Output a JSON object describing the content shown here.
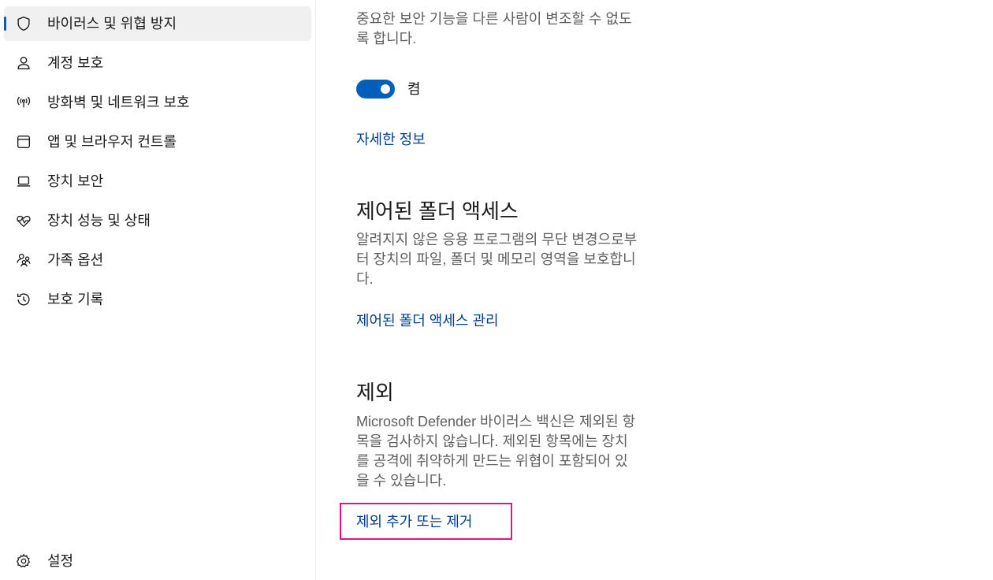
{
  "sidebar": {
    "items": [
      {
        "id": "virus",
        "label": "바이러스 및 위협 방지",
        "icon": "shield-icon",
        "selected": true
      },
      {
        "id": "account",
        "label": "계정 보호",
        "icon": "person-icon",
        "selected": false
      },
      {
        "id": "firewall",
        "label": "방화벽 및 네트워크 보호",
        "icon": "antenna-icon",
        "selected": false
      },
      {
        "id": "app",
        "label": "앱 및 브라우저 컨트롤",
        "icon": "browser-window-icon",
        "selected": false
      },
      {
        "id": "device-security",
        "label": "장치 보안",
        "icon": "laptop-icon",
        "selected": false
      },
      {
        "id": "device-health",
        "label": "장치 성능 및 상태",
        "icon": "heart-pulse-icon",
        "selected": false
      },
      {
        "id": "family",
        "label": "가족 옵션",
        "icon": "family-icon",
        "selected": false
      },
      {
        "id": "history",
        "label": "보호 기록",
        "icon": "history-icon",
        "selected": false
      }
    ],
    "settings_label": "설정"
  },
  "tamper": {
    "desc_line1": "중요한 보안 기능을 다른 사람이 변조할 수 없도",
    "desc_line2": "록 합니다.",
    "toggle_label": "켬",
    "toggle_on": true,
    "link": "자세한 정보"
  },
  "folder_access": {
    "title": "제어된 폴더 액세스",
    "desc_line1": "알려지지 않은 응용 프로그램의 무단 변경으로부",
    "desc_line2": "터 장치의 파일, 폴더 및 메모리 영역을 보호합니",
    "desc_line3": "다.",
    "link": "제어된 폴더 액세스 관리"
  },
  "exclusions": {
    "title": "제외",
    "desc_line1": "Microsoft Defender 바이러스 백신은 제외된 항",
    "desc_line2": "목을 검사하지 않습니다. 제외된 항목에는 장치",
    "desc_line3": "를 공격에 취약하게 만드는 위협이 포함되어 있",
    "desc_line4": "을 수 있습니다.",
    "link": "제외 추가 또는 제거"
  },
  "colors": {
    "accent": "#005fb8",
    "link": "#003e92",
    "focus": "#e3128a"
  }
}
